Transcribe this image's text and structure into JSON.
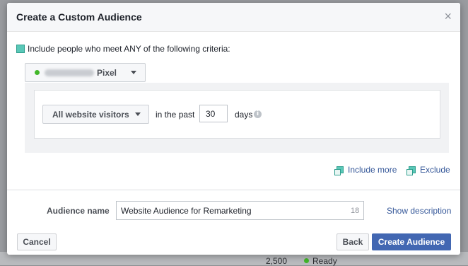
{
  "backdrop": {
    "row_value": "2,500",
    "row_status": "Ready"
  },
  "modal": {
    "title": "Create a Custom Audience",
    "close_glyph": "×",
    "criteria_text": "Include people who meet ANY of the following criteria:",
    "pixel_dropdown": {
      "label": "Pixel"
    },
    "rule": {
      "visitors_option": "All website visitors",
      "past_label": "in the past",
      "days_value": "30",
      "days_label": "days",
      "info_glyph": "i"
    },
    "links": {
      "include_more": "Include more",
      "exclude": "Exclude"
    },
    "audience_name": {
      "label": "Audience name",
      "value": "Website Audience for Remarketing",
      "char_count": "18",
      "show_description": "Show description"
    },
    "buttons": {
      "cancel": "Cancel",
      "back": "Back",
      "create": "Create Audience"
    }
  },
  "colors": {
    "accent_blue": "#4267b2",
    "link_blue": "#365899",
    "status_green": "#42b72a"
  }
}
